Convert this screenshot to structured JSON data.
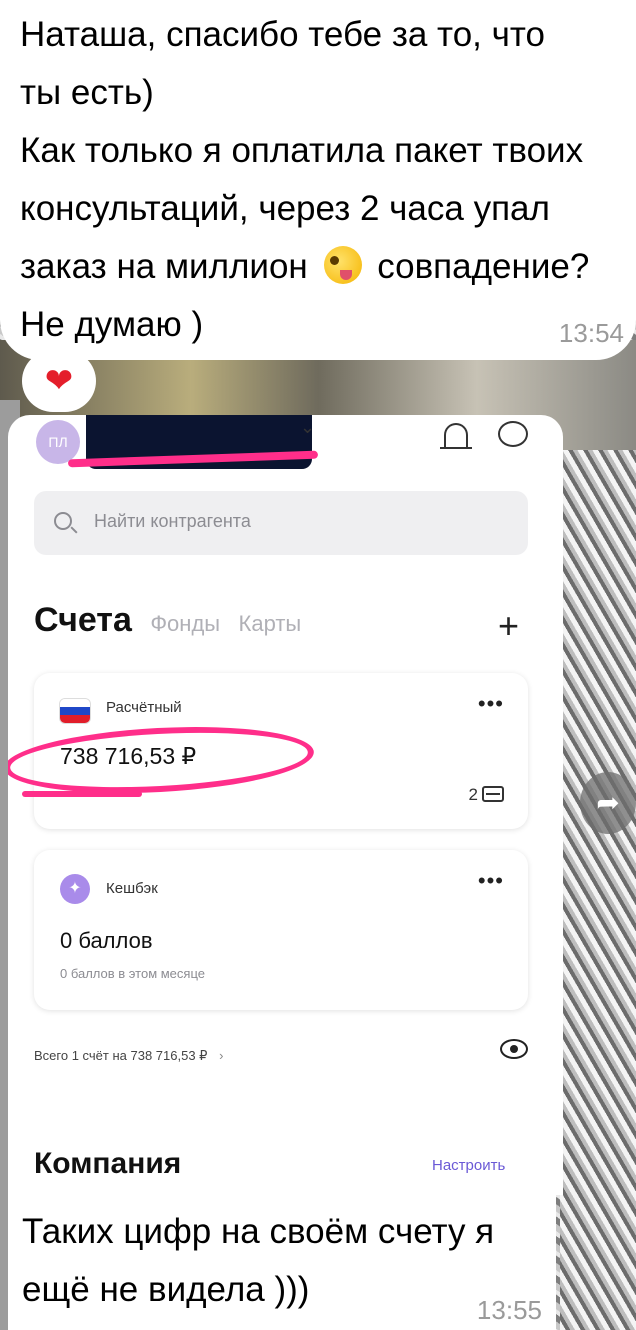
{
  "message1": {
    "lines": [
      "Наташа, спасибо тебе за то, что",
      "ты есть)",
      "Как только я оплатила пакет твоих",
      "консультаций, через 2 часа упал",
      "заказ на миллион",
      "совпадение?",
      "Не думаю )"
    ],
    "time": "13:54",
    "reaction": "❤"
  },
  "screenshot": {
    "avatar": "ПЛ",
    "search_placeholder": "Найти контрагента",
    "tabs": {
      "active": "Счета",
      "others": [
        "Фонды",
        "Карты"
      ]
    },
    "add": "+",
    "account": {
      "name": "Расчётный",
      "balance": "738 716,53 ₽",
      "cards_count": "2",
      "menu": "•••"
    },
    "cashback": {
      "name": "Кешбэк",
      "points": "0 баллов",
      "subtitle": "0 баллов в этом месяце",
      "menu": "•••"
    },
    "total": "Всего 1 счёт на 738 716,53 ₽",
    "total_chevron": "›",
    "company": "Компания",
    "setup": "Настроить"
  },
  "message2": {
    "lines": [
      "Таких цифр на своём счету я",
      "ещё не видела )))"
    ],
    "time": "13:55"
  },
  "share_icon": "➦"
}
